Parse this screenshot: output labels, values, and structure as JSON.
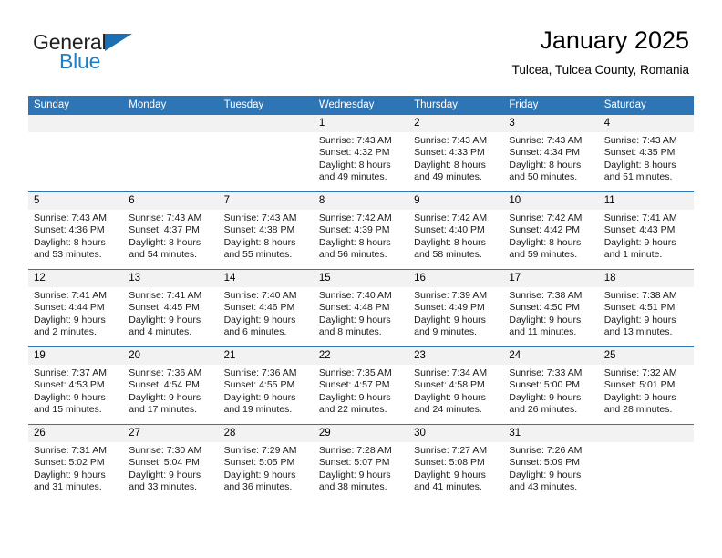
{
  "brand": {
    "name_top": "General",
    "name_bottom": "Blue",
    "triangle_icon": "triangle-logo-icon",
    "color_blue": "#1f7fc4",
    "color_dark": "#231f20"
  },
  "header": {
    "title": "January 2025",
    "subtitle": "Tulcea, Tulcea County, Romania"
  },
  "theme": {
    "header_blue": "#2e75b6",
    "daynum_bg": "#f2f2f2",
    "text": "#000000"
  },
  "weekdays": [
    "Sunday",
    "Monday",
    "Tuesday",
    "Wednesday",
    "Thursday",
    "Friday",
    "Saturday"
  ],
  "weeks": [
    [
      {
        "day": "",
        "empty": true,
        "sunrise": "",
        "sunset": "",
        "daylight1": "",
        "daylight2": ""
      },
      {
        "day": "",
        "empty": true,
        "sunrise": "",
        "sunset": "",
        "daylight1": "",
        "daylight2": ""
      },
      {
        "day": "",
        "empty": true,
        "sunrise": "",
        "sunset": "",
        "daylight1": "",
        "daylight2": ""
      },
      {
        "day": "1",
        "sunrise": "Sunrise: 7:43 AM",
        "sunset": "Sunset: 4:32 PM",
        "daylight1": "Daylight: 8 hours",
        "daylight2": "and 49 minutes."
      },
      {
        "day": "2",
        "sunrise": "Sunrise: 7:43 AM",
        "sunset": "Sunset: 4:33 PM",
        "daylight1": "Daylight: 8 hours",
        "daylight2": "and 49 minutes."
      },
      {
        "day": "3",
        "sunrise": "Sunrise: 7:43 AM",
        "sunset": "Sunset: 4:34 PM",
        "daylight1": "Daylight: 8 hours",
        "daylight2": "and 50 minutes."
      },
      {
        "day": "4",
        "sunrise": "Sunrise: 7:43 AM",
        "sunset": "Sunset: 4:35 PM",
        "daylight1": "Daylight: 8 hours",
        "daylight2": "and 51 minutes."
      }
    ],
    [
      {
        "day": "5",
        "sunrise": "Sunrise: 7:43 AM",
        "sunset": "Sunset: 4:36 PM",
        "daylight1": "Daylight: 8 hours",
        "daylight2": "and 53 minutes."
      },
      {
        "day": "6",
        "sunrise": "Sunrise: 7:43 AM",
        "sunset": "Sunset: 4:37 PM",
        "daylight1": "Daylight: 8 hours",
        "daylight2": "and 54 minutes."
      },
      {
        "day": "7",
        "sunrise": "Sunrise: 7:43 AM",
        "sunset": "Sunset: 4:38 PM",
        "daylight1": "Daylight: 8 hours",
        "daylight2": "and 55 minutes."
      },
      {
        "day": "8",
        "sunrise": "Sunrise: 7:42 AM",
        "sunset": "Sunset: 4:39 PM",
        "daylight1": "Daylight: 8 hours",
        "daylight2": "and 56 minutes."
      },
      {
        "day": "9",
        "sunrise": "Sunrise: 7:42 AM",
        "sunset": "Sunset: 4:40 PM",
        "daylight1": "Daylight: 8 hours",
        "daylight2": "and 58 minutes."
      },
      {
        "day": "10",
        "sunrise": "Sunrise: 7:42 AM",
        "sunset": "Sunset: 4:42 PM",
        "daylight1": "Daylight: 8 hours",
        "daylight2": "and 59 minutes."
      },
      {
        "day": "11",
        "sunrise": "Sunrise: 7:41 AM",
        "sunset": "Sunset: 4:43 PM",
        "daylight1": "Daylight: 9 hours",
        "daylight2": "and 1 minute."
      }
    ],
    [
      {
        "day": "12",
        "sunrise": "Sunrise: 7:41 AM",
        "sunset": "Sunset: 4:44 PM",
        "daylight1": "Daylight: 9 hours",
        "daylight2": "and 2 minutes."
      },
      {
        "day": "13",
        "sunrise": "Sunrise: 7:41 AM",
        "sunset": "Sunset: 4:45 PM",
        "daylight1": "Daylight: 9 hours",
        "daylight2": "and 4 minutes."
      },
      {
        "day": "14",
        "sunrise": "Sunrise: 7:40 AM",
        "sunset": "Sunset: 4:46 PM",
        "daylight1": "Daylight: 9 hours",
        "daylight2": "and 6 minutes."
      },
      {
        "day": "15",
        "sunrise": "Sunrise: 7:40 AM",
        "sunset": "Sunset: 4:48 PM",
        "daylight1": "Daylight: 9 hours",
        "daylight2": "and 8 minutes."
      },
      {
        "day": "16",
        "sunrise": "Sunrise: 7:39 AM",
        "sunset": "Sunset: 4:49 PM",
        "daylight1": "Daylight: 9 hours",
        "daylight2": "and 9 minutes."
      },
      {
        "day": "17",
        "sunrise": "Sunrise: 7:38 AM",
        "sunset": "Sunset: 4:50 PM",
        "daylight1": "Daylight: 9 hours",
        "daylight2": "and 11 minutes."
      },
      {
        "day": "18",
        "sunrise": "Sunrise: 7:38 AM",
        "sunset": "Sunset: 4:51 PM",
        "daylight1": "Daylight: 9 hours",
        "daylight2": "and 13 minutes."
      }
    ],
    [
      {
        "day": "19",
        "sunrise": "Sunrise: 7:37 AM",
        "sunset": "Sunset: 4:53 PM",
        "daylight1": "Daylight: 9 hours",
        "daylight2": "and 15 minutes."
      },
      {
        "day": "20",
        "sunrise": "Sunrise: 7:36 AM",
        "sunset": "Sunset: 4:54 PM",
        "daylight1": "Daylight: 9 hours",
        "daylight2": "and 17 minutes."
      },
      {
        "day": "21",
        "sunrise": "Sunrise: 7:36 AM",
        "sunset": "Sunset: 4:55 PM",
        "daylight1": "Daylight: 9 hours",
        "daylight2": "and 19 minutes."
      },
      {
        "day": "22",
        "sunrise": "Sunrise: 7:35 AM",
        "sunset": "Sunset: 4:57 PM",
        "daylight1": "Daylight: 9 hours",
        "daylight2": "and 22 minutes."
      },
      {
        "day": "23",
        "sunrise": "Sunrise: 7:34 AM",
        "sunset": "Sunset: 4:58 PM",
        "daylight1": "Daylight: 9 hours",
        "daylight2": "and 24 minutes."
      },
      {
        "day": "24",
        "sunrise": "Sunrise: 7:33 AM",
        "sunset": "Sunset: 5:00 PM",
        "daylight1": "Daylight: 9 hours",
        "daylight2": "and 26 minutes."
      },
      {
        "day": "25",
        "sunrise": "Sunrise: 7:32 AM",
        "sunset": "Sunset: 5:01 PM",
        "daylight1": "Daylight: 9 hours",
        "daylight2": "and 28 minutes."
      }
    ],
    [
      {
        "day": "26",
        "sunrise": "Sunrise: 7:31 AM",
        "sunset": "Sunset: 5:02 PM",
        "daylight1": "Daylight: 9 hours",
        "daylight2": "and 31 minutes."
      },
      {
        "day": "27",
        "sunrise": "Sunrise: 7:30 AM",
        "sunset": "Sunset: 5:04 PM",
        "daylight1": "Daylight: 9 hours",
        "daylight2": "and 33 minutes."
      },
      {
        "day": "28",
        "sunrise": "Sunrise: 7:29 AM",
        "sunset": "Sunset: 5:05 PM",
        "daylight1": "Daylight: 9 hours",
        "daylight2": "and 36 minutes."
      },
      {
        "day": "29",
        "sunrise": "Sunrise: 7:28 AM",
        "sunset": "Sunset: 5:07 PM",
        "daylight1": "Daylight: 9 hours",
        "daylight2": "and 38 minutes."
      },
      {
        "day": "30",
        "sunrise": "Sunrise: 7:27 AM",
        "sunset": "Sunset: 5:08 PM",
        "daylight1": "Daylight: 9 hours",
        "daylight2": "and 41 minutes."
      },
      {
        "day": "31",
        "sunrise": "Sunrise: 7:26 AM",
        "sunset": "Sunset: 5:09 PM",
        "daylight1": "Daylight: 9 hours",
        "daylight2": "and 43 minutes."
      },
      {
        "day": "",
        "empty": true,
        "sunrise": "",
        "sunset": "",
        "daylight1": "",
        "daylight2": ""
      }
    ]
  ]
}
